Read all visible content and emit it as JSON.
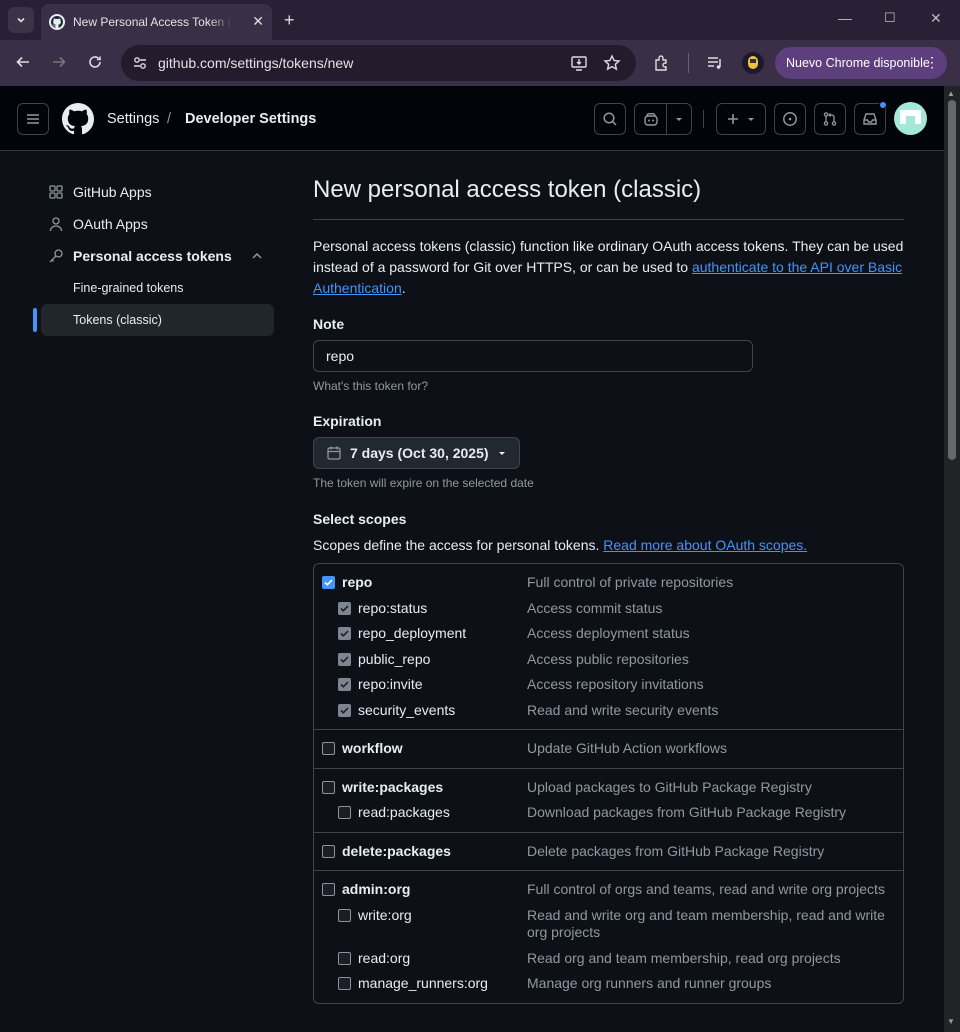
{
  "browser": {
    "tab_title": "New Personal Access Token (Classic)",
    "url": "github.com/settings/tokens/new",
    "update_label": "Nuevo Chrome disponible"
  },
  "header": {
    "crumb_settings": "Settings",
    "crumb_separator": "/",
    "crumb_developer": "Developer Settings"
  },
  "sidebar": {
    "items": [
      {
        "label": "GitHub Apps"
      },
      {
        "label": "OAuth Apps"
      },
      {
        "label": "Personal access tokens"
      },
      {
        "label": "Fine-grained tokens"
      },
      {
        "label": "Tokens (classic)"
      }
    ]
  },
  "main": {
    "title": "New personal access token (classic)",
    "intro": "Personal access tokens (classic) function like ordinary OAuth access tokens. They can be used instead of a password for Git over HTTPS, or can be used to ",
    "intro_link": "authenticate to the API over Basic Authentication",
    "intro_end": ".",
    "note_label": "Note",
    "note_value": "repo",
    "note_hint": "What's this token for?",
    "expiration_label": "Expiration",
    "expiration_value": "7 days (Oct 30, 2025)",
    "expiration_hint": "The token will expire on the selected date",
    "scopes_label": "Select scopes",
    "scopes_desc": "Scopes define the access for personal tokens. ",
    "scopes_link": "Read more about OAuth scopes."
  },
  "scopes": [
    {
      "name": "repo",
      "desc": "Full control of private repositories",
      "checked": true,
      "children": [
        {
          "name": "repo:status",
          "desc": "Access commit status",
          "checked": true
        },
        {
          "name": "repo_deployment",
          "desc": "Access deployment status",
          "checked": true
        },
        {
          "name": "public_repo",
          "desc": "Access public repositories",
          "checked": true
        },
        {
          "name": "repo:invite",
          "desc": "Access repository invitations",
          "checked": true
        },
        {
          "name": "security_events",
          "desc": "Read and write security events",
          "checked": true
        }
      ]
    },
    {
      "name": "workflow",
      "desc": "Update GitHub Action workflows",
      "checked": false,
      "children": []
    },
    {
      "name": "write:packages",
      "desc": "Upload packages to GitHub Package Registry",
      "checked": false,
      "children": [
        {
          "name": "read:packages",
          "desc": "Download packages from GitHub Package Registry",
          "checked": false
        }
      ]
    },
    {
      "name": "delete:packages",
      "desc": "Delete packages from GitHub Package Registry",
      "checked": false,
      "children": []
    },
    {
      "name": "admin:org",
      "desc": "Full control of orgs and teams, read and write org projects",
      "checked": false,
      "children": [
        {
          "name": "write:org",
          "desc": "Read and write org and team membership, read and write org projects",
          "checked": false
        },
        {
          "name": "read:org",
          "desc": "Read org and team membership, read org projects",
          "checked": false
        },
        {
          "name": "manage_runners:org",
          "desc": "Manage org runners and runner groups",
          "checked": false
        }
      ]
    }
  ]
}
